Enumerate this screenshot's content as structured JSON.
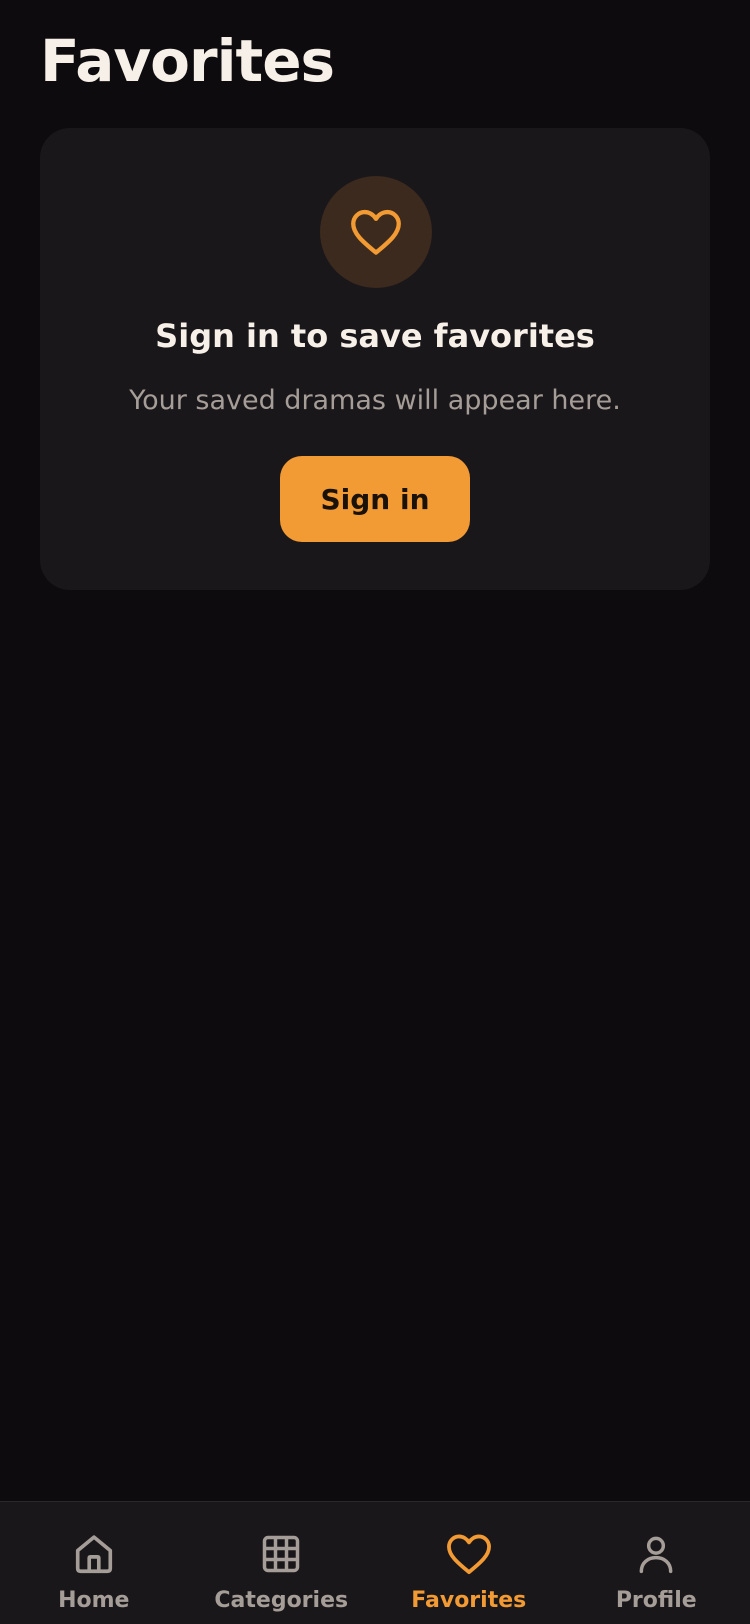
{
  "header": {
    "title": "Favorites"
  },
  "empty_state": {
    "icon": "heart-icon",
    "heading": "Sign in to save favorites",
    "subtitle": "Your saved dramas will appear here.",
    "button_label": "Sign in"
  },
  "tabbar": {
    "items": [
      {
        "label": "Home",
        "icon": "home-icon",
        "active": false
      },
      {
        "label": "Categories",
        "icon": "grid-icon",
        "active": false
      },
      {
        "label": "Favorites",
        "icon": "heart-icon",
        "active": true
      },
      {
        "label": "Profile",
        "icon": "user-icon",
        "active": false
      }
    ]
  },
  "colors": {
    "background": "#0d0b0e",
    "card": "#1a171b",
    "accent": "#f29a33",
    "text_primary": "#f7f0e8",
    "text_secondary": "#a59d97"
  }
}
